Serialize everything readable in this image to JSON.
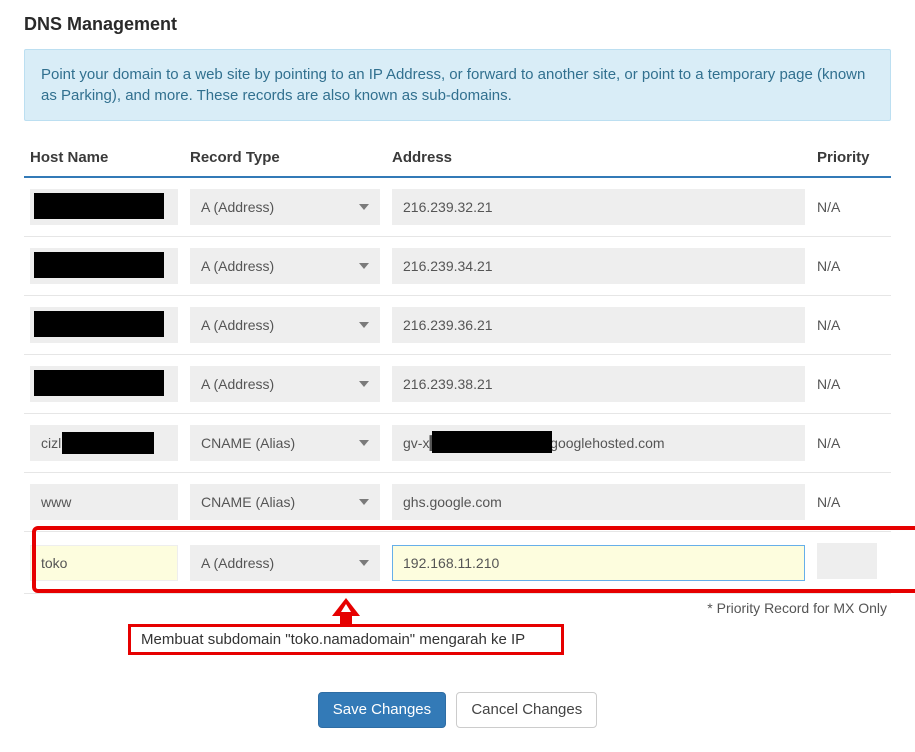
{
  "page": {
    "title": "DNS Management",
    "info": "Point your domain to a web site by pointing to an IP Address, or forward to another site, or point to a temporary page (known as Parking), and more. These records are also known as sub-domains.",
    "priority_note": "* Priority Record for MX Only"
  },
  "columns": {
    "host": "Host Name",
    "type": "Record Type",
    "addr": "Address",
    "prio": "Priority"
  },
  "record_types": {
    "a": "A (Address)",
    "cname": "CNAME (Alias)"
  },
  "rows": [
    {
      "host": "",
      "host_redacted": "full",
      "type_key": "a",
      "addr": "216.239.32.21",
      "prio": "N/A"
    },
    {
      "host": "",
      "host_redacted": "full",
      "type_key": "a",
      "addr": "216.239.34.21",
      "prio": "N/A"
    },
    {
      "host": "",
      "host_redacted": "full",
      "type_key": "a",
      "addr": "216.239.36.21",
      "prio": "N/A"
    },
    {
      "host": "",
      "host_redacted": "full",
      "type_key": "a",
      "addr": "216.239.38.21",
      "prio": "N/A"
    },
    {
      "host": "cizl",
      "host_redacted": "partial",
      "type_key": "cname",
      "addr": "gv-x██████████.dv.googlehosted.com",
      "addr_redacted": true,
      "prio": "N/A"
    },
    {
      "host": "www",
      "host_redacted": "none",
      "type_key": "cname",
      "addr": "ghs.google.com",
      "prio": "N/A"
    },
    {
      "host": "toko",
      "host_redacted": "none",
      "type_key": "a",
      "addr": "192.168.11.210",
      "prio": "",
      "highlight": true
    }
  ],
  "buttons": {
    "save": "Save Changes",
    "cancel": "Cancel Changes"
  },
  "annotation": {
    "label": "Membuat subdomain \"toko.namadomain\" mengarah ke IP"
  }
}
